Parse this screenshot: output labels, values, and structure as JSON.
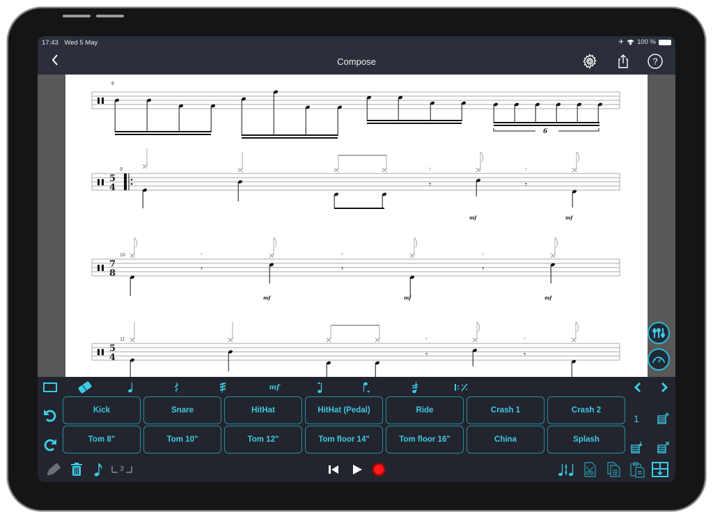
{
  "status_bar": {
    "time": "17:43",
    "date": "Wed 5 May",
    "battery": "100 %",
    "icons": [
      "airplane-icon",
      "wifi-icon",
      "battery-icon"
    ]
  },
  "nav": {
    "title": "Compose",
    "back_icon": "chevron-left-icon",
    "right_icons": [
      "gear-icon",
      "share-icon",
      "help-icon"
    ]
  },
  "score": {
    "measures": [
      {
        "number": "8",
        "time_signature": "",
        "tuplet": "6"
      },
      {
        "number": "9",
        "time_signature": "5/4",
        "repeat_start": true,
        "dynamics": [
          "mf",
          "mf"
        ]
      },
      {
        "number": "10",
        "time_signature": "7/8",
        "dynamics": [
          "mf",
          "mf",
          "mf"
        ]
      },
      {
        "number": "11",
        "time_signature": "5/4"
      }
    ]
  },
  "side_buttons": [
    "mixer-icon",
    "tempo-gauge-icon"
  ],
  "toolbar": {
    "tools": [
      {
        "name": "selection-rect-icon"
      },
      {
        "name": "eraser-icon"
      },
      {
        "name": "quarter-note-icon"
      },
      {
        "name": "quarter-rest-icon"
      },
      {
        "name": "tremolo-icon"
      },
      {
        "name": "dynamics-icon",
        "label": "mf"
      },
      {
        "name": "stem-up-icon"
      },
      {
        "name": "stem-down-icon"
      },
      {
        "name": "accent-icon"
      },
      {
        "name": "repeat-icon",
        "label": "𝄆 ⁄"
      }
    ],
    "nav_prev": "chevron-left-icon",
    "nav_next": "chevron-right-icon",
    "undo": "undo-icon",
    "redo": "redo-icon",
    "pads_row1": [
      "Kick",
      "Snare",
      "HitHat",
      "HitHat (Pedal)",
      "Ride",
      "Crash 1",
      "Crash 2"
    ],
    "pads_row2": [
      "Tom 8\"",
      "Tom 10\"",
      "Tom 12\"",
      "Tom floor 14\"",
      "Tom floor 16\"",
      "China",
      "Splash"
    ],
    "page_number": "1",
    "tuplet_label": "3",
    "bottom_left_icons": [
      "marker-icon",
      "trash-icon",
      "eighth-note-icon",
      "tuplet-bracket-icon"
    ],
    "transport_icons": [
      "skip-back-icon",
      "play-icon",
      "record-icon"
    ],
    "bottom_right_icons": [
      "voices-icon",
      "cut-icon",
      "copy-icon",
      "paste-icon",
      "insert-bar-icon"
    ],
    "colors": {
      "accent": "#3ccbe8",
      "record": "#ff1a1a",
      "pad_border": "#2a8ea4",
      "bg": "#22252d"
    }
  }
}
